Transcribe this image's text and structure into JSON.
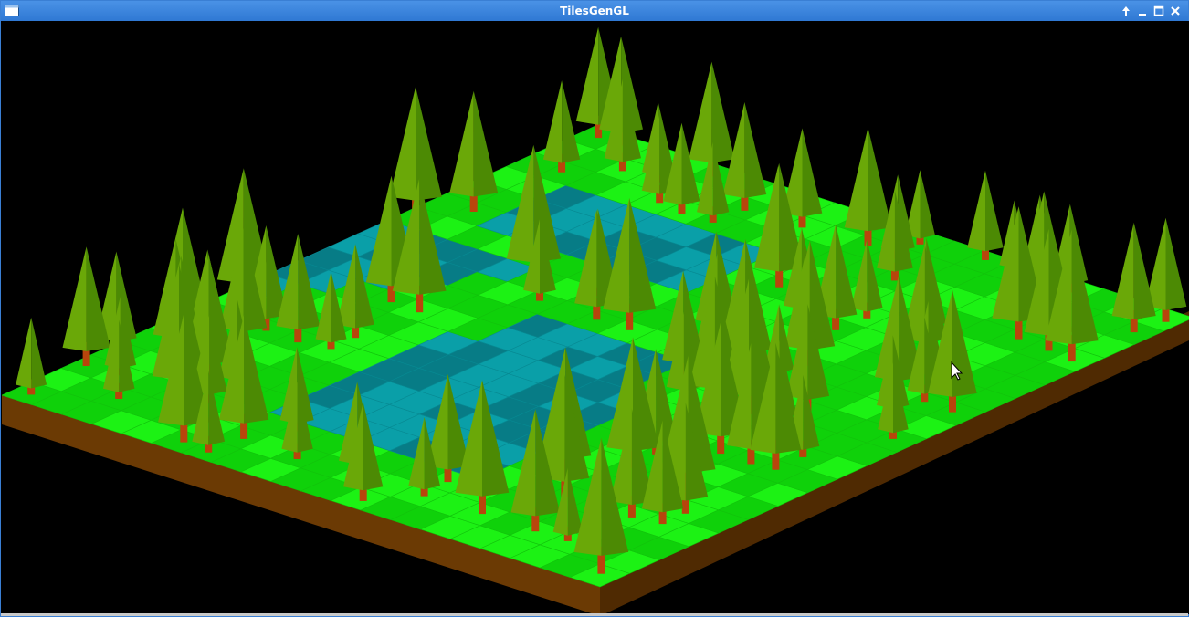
{
  "window": {
    "title": "TilesGenGL",
    "controls": [
      "shade-icon",
      "minimize-icon",
      "maximize-icon",
      "close-icon"
    ]
  },
  "scene": {
    "description_colors": {
      "grass_light": "#1cf214",
      "grass_dark": "#0fd10a",
      "water": "#0a9fa8",
      "water_dark": "#077c86",
      "dirt": "#6b3a04",
      "dirt_dark": "#4f2a02",
      "tree_foliage": "#6aa808",
      "tree_foliage_dark": "#4c8a04",
      "tree_trunk": "#b8450c",
      "background": "#000000"
    },
    "cursor": "arrow-cursor-icon"
  }
}
